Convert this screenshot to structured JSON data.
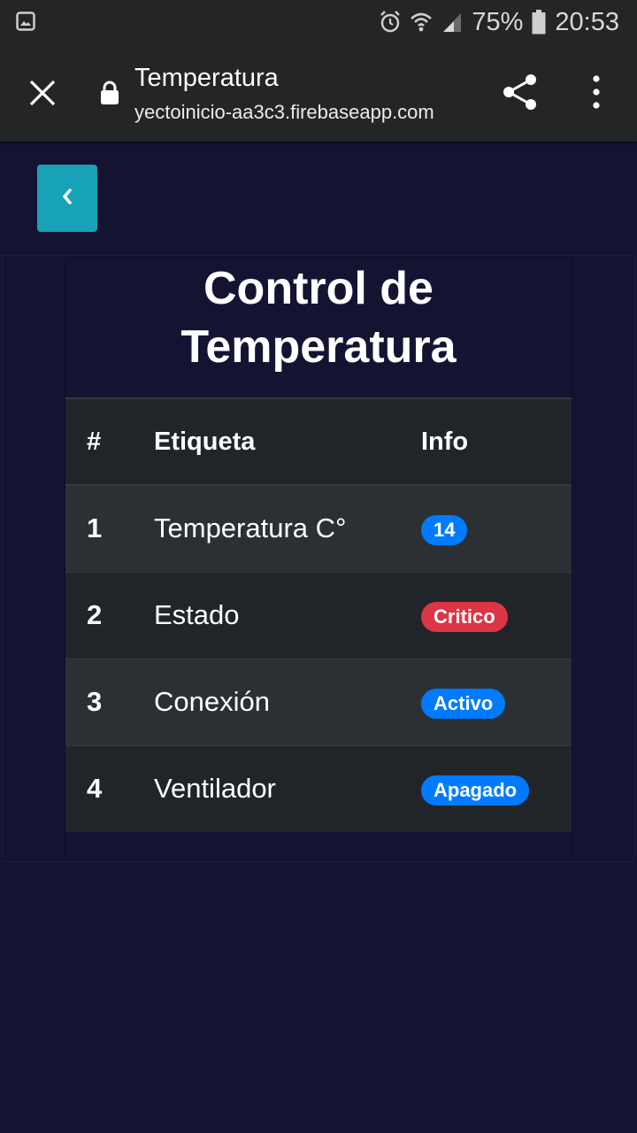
{
  "status_bar": {
    "battery": "75%",
    "time": "20:53",
    "icons": [
      "gallery-icon",
      "alarm-icon",
      "wifi-icon",
      "signal-icon",
      "battery-icon"
    ]
  },
  "browser": {
    "title": "Temperatura",
    "host": "yectoinicio-aa3c3.firebaseapp.com",
    "icons": [
      "close-icon",
      "lock-icon",
      "share-icon",
      "more-vert-icon"
    ]
  },
  "back_button": {
    "icon": "chevron-left-icon",
    "color": "#17a2b8"
  },
  "page": {
    "title_line1": "Control de",
    "title_line2": "Temperatura"
  },
  "table": {
    "headers": [
      "#",
      "Etiqueta",
      "Info"
    ],
    "rows": [
      {
        "num": "1",
        "label": "Temperatura C°",
        "info": "14",
        "badge_color": "#007bff"
      },
      {
        "num": "2",
        "label": "Estado",
        "info": "Critico",
        "badge_color": "#dc3545"
      },
      {
        "num": "3",
        "label": "Conexión",
        "info": "Activo",
        "badge_color": "#007bff"
      },
      {
        "num": "4",
        "label": "Ventilador",
        "info": "Apagado",
        "badge_color": "#007bff"
      }
    ]
  },
  "colors": {
    "background": "#141432",
    "toolbar": "#232526",
    "row_dark": "#212529",
    "row_light": "#2c3034"
  }
}
